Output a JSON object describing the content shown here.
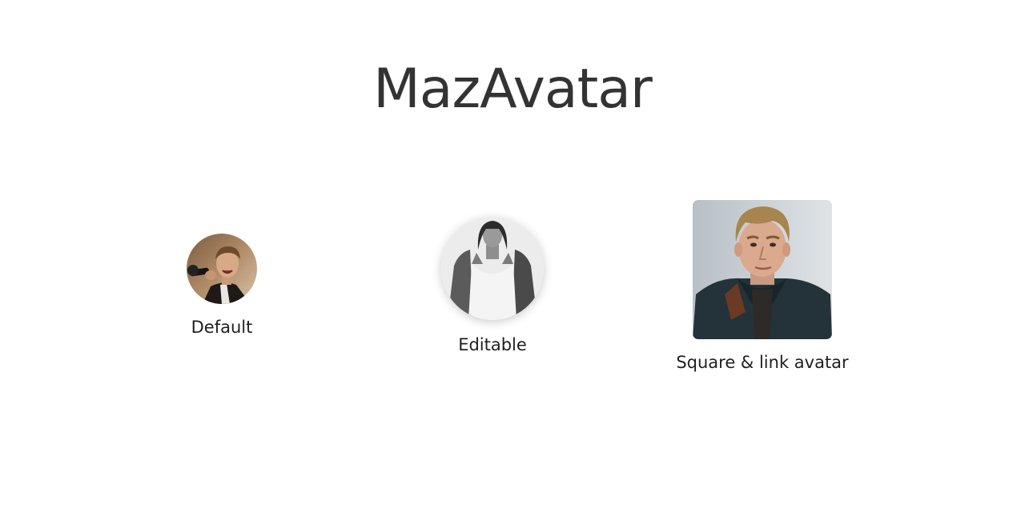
{
  "page": {
    "title": "MazAvatar"
  },
  "avatars": [
    {
      "caption": "Default",
      "variant": "round",
      "image": "photo-man-microphone"
    },
    {
      "caption": "Editable",
      "variant": "round-editable",
      "image": "photo-man-tank-top-grayscale"
    },
    {
      "caption": "Square & link avatar",
      "variant": "square-link",
      "image": "photo-man-portrait-jacket"
    }
  ]
}
